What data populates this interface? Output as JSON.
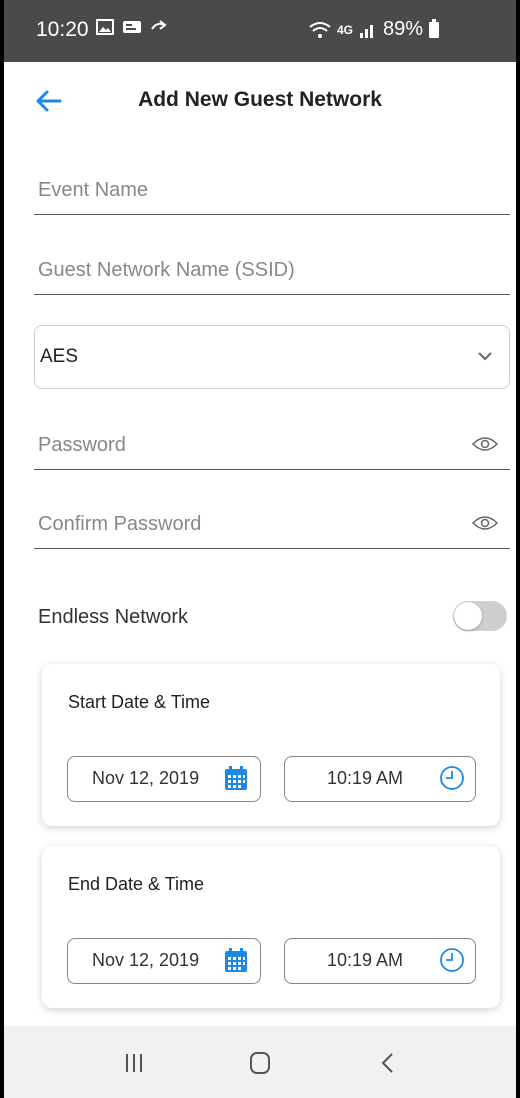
{
  "status_bar": {
    "time": "10:20",
    "network": "4G",
    "battery": "89%"
  },
  "header": {
    "title": "Add New Guest Network"
  },
  "form": {
    "event_name_placeholder": "Event Name",
    "ssid_placeholder": "Guest Network Name (SSID)",
    "security_value": "AES",
    "password_placeholder": "Password",
    "confirm_password_placeholder": "Confirm Password",
    "endless_label": "Endless Network",
    "endless_on": false
  },
  "start": {
    "title": "Start Date & Time",
    "date": "Nov 12, 2019",
    "time": "10:19 AM"
  },
  "end": {
    "title": "End Date & Time",
    "date": "Nov 12, 2019",
    "time": "10:19 AM"
  },
  "colors": {
    "accent": "#1e88e5",
    "status_bar": "#4a4a4a",
    "nav_bar": "#f1f1f1"
  },
  "icons": [
    "image-icon",
    "message-icon",
    "share-icon",
    "wifi-icon",
    "signal-icon",
    "battery-icon",
    "back-arrow-icon",
    "chevron-down-icon",
    "eye-icon",
    "calendar-icon",
    "clock-icon",
    "recents-icon",
    "home-icon",
    "back-icon"
  ]
}
